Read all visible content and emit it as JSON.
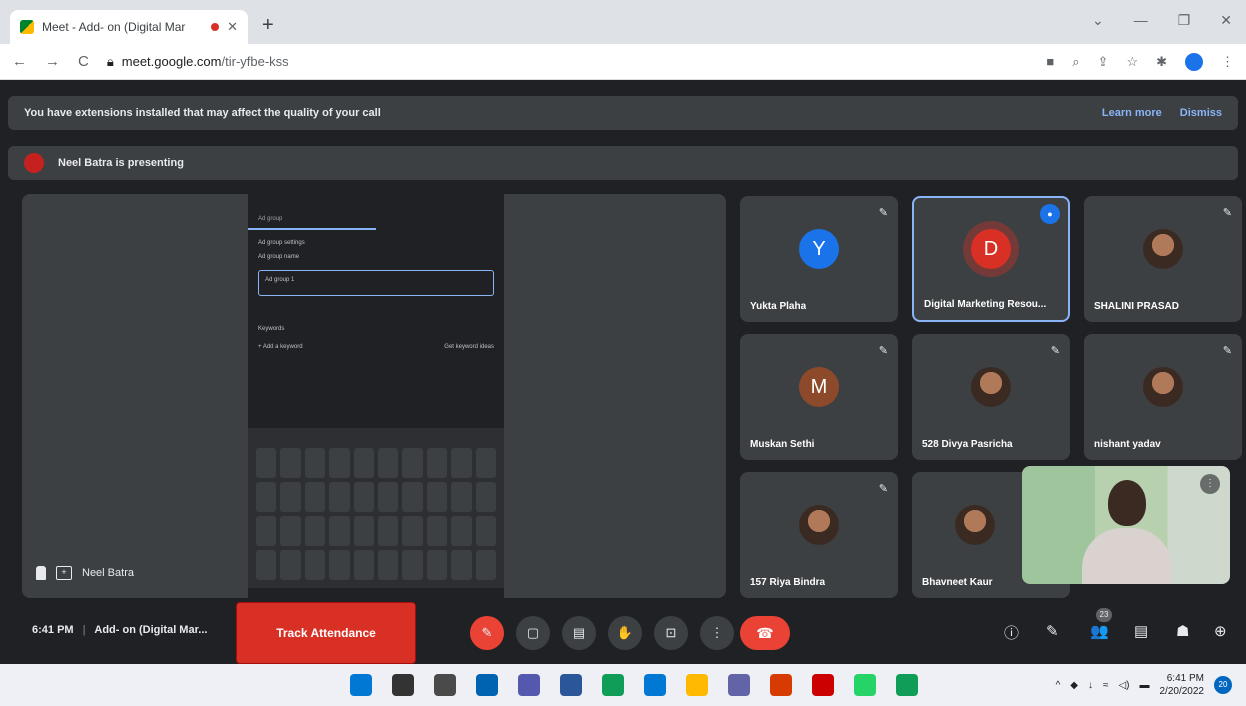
{
  "browser": {
    "tab_title": "Meet - Add- on (Digital Mar",
    "tab_close": "✕",
    "new_tab": "+",
    "win_controls": [
      "⌄",
      "—",
      "❐",
      "✕"
    ],
    "nav_icons": [
      "←",
      "→",
      "C"
    ],
    "url_host": "meet.google.com",
    "url_path": "/tir-yfbe-kss",
    "toolbar_icons": [
      "■",
      "⌕",
      "⇪",
      "☆",
      "✱",
      "⋮"
    ]
  },
  "banner": {
    "text": "You have extensions installed that may affect the quality of your call",
    "learn_more": "Learn more",
    "dismiss": "Dismiss"
  },
  "presenting": {
    "text": "Neel Batra is presenting"
  },
  "stage": {
    "presenter_name": "Neel Batra",
    "present_icon": "+"
  },
  "phone": {
    "appbar": "Ad group",
    "heading": "Ad group settings",
    "name_label": "Ad group name",
    "field_value": "Ad group 1",
    "keywords": "Keywords",
    "add_keyword": "+ Add a keyword",
    "ideas": "Get keyword ideas"
  },
  "participants": [
    {
      "name": "Yukta Plaha",
      "initial": "Y",
      "color": "#1a73e8",
      "mic": "muted"
    },
    {
      "name": "Digital Marketing Resou...",
      "initial": "D",
      "color": "#d93025",
      "mic": "speaking"
    },
    {
      "name": "SHALINI PRASAD",
      "initial": "",
      "color": "",
      "mic": "muted"
    },
    {
      "name": "Muskan Sethi",
      "initial": "M",
      "color": "#8d4a2b",
      "mic": "muted"
    },
    {
      "name": "528 Divya Pasricha",
      "initial": "",
      "color": "",
      "mic": "muted"
    },
    {
      "name": "nishant yadav",
      "initial": "",
      "color": "",
      "mic": "muted"
    },
    {
      "name": "157 Riya Bindra",
      "initial": "",
      "color": "",
      "mic": "muted"
    },
    {
      "name": "Bhavneet Kaur",
      "initial": "",
      "color": "",
      "mic": "muted"
    }
  ],
  "mic_glyph": "✎",
  "speak_glyph": "●",
  "self_options": "⋮",
  "bottombar": {
    "time": "6:41 PM",
    "meeting_name": "Add- on (Digital Mar...",
    "track_attendance": "Track Attendance",
    "controls": [
      "✎",
      "▢",
      "▤",
      "✋",
      "⊡",
      "⋮"
    ],
    "hangup": "☎",
    "right_controls": [
      "ⓘ",
      "✎",
      "👥",
      "▤",
      "☗",
      "⊕"
    ],
    "people_count": "23"
  },
  "taskbar": {
    "time": "6:41 PM",
    "date": "2/20/2022",
    "notifications": "20",
    "tray_icons": [
      "^",
      "◆",
      "↓",
      "≈",
      "◁)",
      "▬"
    ],
    "app_colors": [
      "#0078d4",
      "#333333",
      "#4a4a4a",
      "#0063b1",
      "#5558af",
      "#2b579a",
      "#0f9d58",
      "#0078d4",
      "#ffb900",
      "#6264a7",
      "#d83b01",
      "#cc0000",
      "#25d366",
      "#0f9d58"
    ]
  }
}
